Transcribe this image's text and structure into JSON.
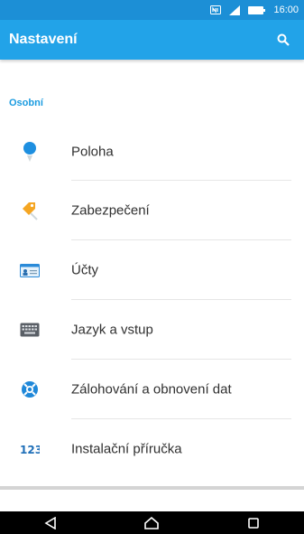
{
  "status_bar": {
    "time": "16:00",
    "icons": [
      "nfc-icon",
      "signal-icon",
      "battery-icon"
    ]
  },
  "app_bar": {
    "title": "Nastavení",
    "action_icon": "search-icon"
  },
  "section": {
    "header": "Osobní"
  },
  "items": [
    {
      "label": "Poloha",
      "icon": "location-pin-icon"
    },
    {
      "label": "Zabezpečení",
      "icon": "security-key-icon"
    },
    {
      "label": "Účty",
      "icon": "accounts-card-icon"
    },
    {
      "label": "Jazyk a vstup",
      "icon": "keyboard-icon"
    },
    {
      "label": "Zálohování a obnovení dat",
      "icon": "backup-lifebuoy-icon"
    },
    {
      "label": "Instalační příručka",
      "icon": "setup-guide-123-icon"
    }
  ],
  "nav_bar": {
    "buttons": [
      "back-icon",
      "home-icon",
      "recents-icon"
    ]
  },
  "colors": {
    "status_bar": "#1c8fd6",
    "app_bar": "#22a3e8",
    "accent": "#1a9be0"
  }
}
